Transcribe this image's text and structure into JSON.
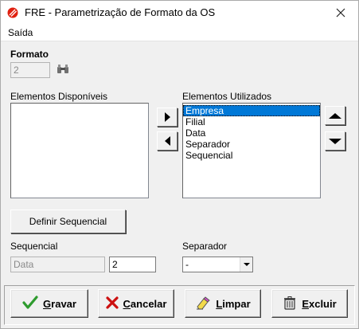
{
  "window": {
    "title": "FRE - Parametrização de Formato da OS",
    "icon": "fre-logo-icon"
  },
  "menu": {
    "items": [
      {
        "label": "Saída"
      }
    ]
  },
  "formato": {
    "label": "Formato",
    "value": "2",
    "search_icon": "binoculars-icon"
  },
  "disponiveis": {
    "label": "Elementos Disponíveis",
    "items": []
  },
  "utilizados": {
    "label": "Elementos Utilizados",
    "items": [
      "Empresa",
      "Filial",
      "Data",
      "Separador",
      "Sequencial"
    ],
    "selected": "Empresa"
  },
  "definir_button": "Definir Sequencial",
  "sequencial": {
    "label": "Sequencial",
    "type_value": "Data",
    "value": "2"
  },
  "separador": {
    "label": "Separador",
    "value": "-"
  },
  "actions": {
    "gravar": {
      "hot": "G",
      "rest": "ravar",
      "icon": "checkmark-icon"
    },
    "cancelar": {
      "hot": "C",
      "rest": "ancelar",
      "icon": "x-icon"
    },
    "limpar": {
      "hot": "L",
      "rest": "impar",
      "icon": "eraser-icon"
    },
    "excluir": {
      "hot": "E",
      "rest": "xcluir",
      "icon": "trash-icon"
    }
  },
  "colors": {
    "selection": "#0078d7",
    "check": "#2e9b2e",
    "cancel": "#cc1010",
    "logo": "#e02010"
  }
}
